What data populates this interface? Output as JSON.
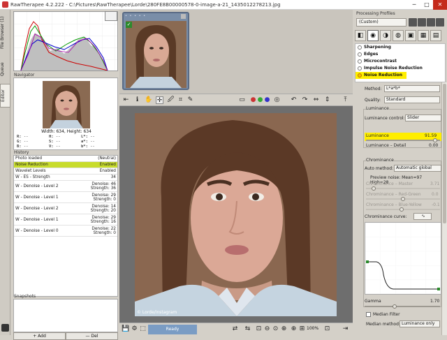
{
  "window": {
    "title": "RawTherapee 4.2.222 - C:\\Pictures\\RawTherapee\\Lorde\\280FE8B00000578-0-image-a-21_1435012278213.jpg",
    "minimize": "─",
    "maximize": "□",
    "close": "✕"
  },
  "left_tabs": [
    "File Browser (1)",
    "Queue",
    "Editor"
  ],
  "navigator": {
    "label": "Navigator",
    "size_text": "Width: 634, Height: 634",
    "readouts": [
      [
        "R:",
        "--",
        "H:",
        "--",
        "L*:",
        "--"
      ],
      [
        "G:",
        "--",
        "S:",
        "--",
        "a*:",
        "--"
      ],
      [
        "B:",
        "--",
        "V:",
        "--",
        "b*:",
        "--"
      ]
    ]
  },
  "history": {
    "label": "History",
    "rows": [
      {
        "name": "Photo loaded",
        "value": "(Neutral)",
        "selected": false
      },
      {
        "name": "Noise Reduction",
        "value": "Enabled",
        "selected": true
      },
      {
        "name": "Wavelet Levels",
        "value": "Enabled",
        "selected": false
      },
      {
        "name": "W - ES - Strength",
        "value": "34",
        "selected": false
      },
      {
        "name": "W - Denoise - Level 2",
        "value": "Denoise: 46\nStrength: 36",
        "selected": false
      },
      {
        "name": "W - Denoise - Level 1",
        "value": "Denoise: 29\nStrength: 0",
        "selected": false
      },
      {
        "name": "W - Denoise - Level 2",
        "value": "Denoise: 14\nStrength: 20",
        "selected": false
      },
      {
        "name": "W - Denoise - Level 1",
        "value": "Denoise: 29\nStrength: 16",
        "selected": false
      },
      {
        "name": "W - Denoise - Level 0",
        "value": "Denoise: 22\nStrength: 0",
        "selected": false
      }
    ]
  },
  "snapshots": {
    "label": "Snapshots",
    "add": "+ Add",
    "del": "— Del"
  },
  "filmstrip": {
    "stars": "• • • • •",
    "check": "✓",
    "trash": "🗑"
  },
  "photo": {
    "credit": "© Lorde/Instagram"
  },
  "statusbar": {
    "ready": "Ready",
    "zoom": "100%"
  },
  "right": {
    "processing_profiles_label": "Processing Profiles",
    "profile_value": "(Custom)",
    "tools": [
      {
        "label": "Sharpening",
        "highlight": false
      },
      {
        "label": "Edges",
        "highlight": false
      },
      {
        "label": "Microcontrast",
        "highlight": false
      },
      {
        "label": "Impulse Noise Reduction",
        "highlight": false
      },
      {
        "label": "Noise Reduction",
        "highlight": true
      }
    ],
    "method_label": "Method:",
    "method_value": "L*a*b*",
    "quality_label": "Quality:",
    "quality_value": "Standard",
    "luminance_frame": "Luminance",
    "luminance_control_label": "Luminance control:",
    "luminance_control_value": "Slider",
    "luminance_label": "Luminance",
    "luminance_value": "91.59",
    "luminance_fill": 0.93,
    "luminance_detail_label": "Luminance – Detail",
    "luminance_detail_value": "0.00",
    "chrominance_frame": "Chrominance",
    "auto_method_label": "Auto method:",
    "auto_method_value": "Automatic global",
    "preview_noise": "Preview noise: Mean=97  High=28",
    "chroma_master_label": "Chrominance – Master",
    "chroma_master_value": "3.71",
    "chroma_redgreen_label": "Chrominance – Red-Green",
    "chroma_redgreen_value": "0.0",
    "chroma_blueyellow_label": "Chrominance – Blue-Yellow",
    "chroma_blueyellow_value": "-0.1",
    "chroma_curve_label": "Chrominance curve:",
    "gamma_label": "Gamma",
    "gamma_value": "1.70",
    "median_label": "Median Filter",
    "median_method_label": "Median method:",
    "median_method_value": "Luminance only"
  }
}
